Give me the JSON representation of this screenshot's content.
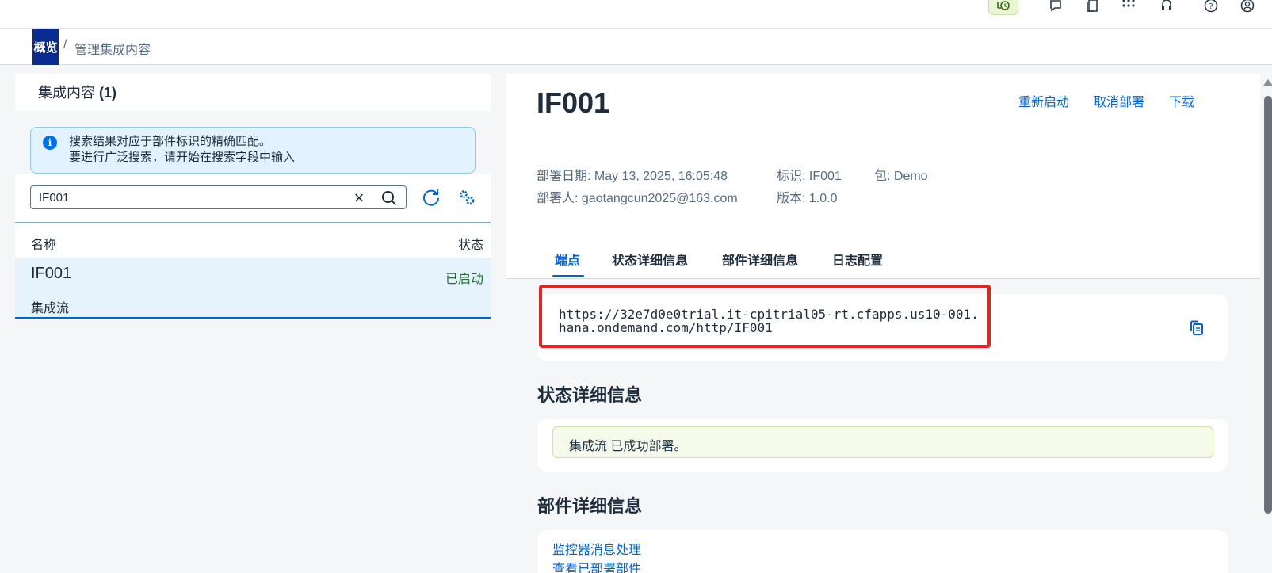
{
  "shell": {
    "icons": [
      "timer-icon",
      "feedback-icon",
      "documents-icon",
      "app-grid-icon",
      "support-icon",
      "help-icon",
      "user-icon"
    ]
  },
  "breadcrumb": {
    "home": "概览",
    "separator": "/",
    "current": "管理集成内容"
  },
  "left": {
    "title": "集成内容",
    "count": "(1)",
    "info_line1": "搜索结果对应于部件标识的精确匹配。",
    "info_line2": "要进行广泛搜索，请开始在搜索字段中输入",
    "search_value": "IF001",
    "columns": {
      "name": "名称",
      "status": "状态"
    },
    "rows": [
      {
        "name": "IF001",
        "type": "集成流",
        "status": "已启动"
      }
    ]
  },
  "detail": {
    "title": "IF001",
    "actions": {
      "restart": "重新启动",
      "undeploy": "取消部署",
      "download": "下载"
    },
    "meta": {
      "deployed_on": "部署日期: May 13, 2025, 16:05:48",
      "deployed_by": "部署人: gaotangcun2025@163.com",
      "id": "标识: IF001",
      "version": "版本: 1.0.0",
      "package": "包: Demo"
    },
    "tabs": [
      "端点",
      "状态详细信息",
      "部件详细信息",
      "日志配置"
    ],
    "selected_tab": "端点",
    "endpoint_url": "https://32e7d0e0trial.it-cpitrial05-rt.cfapps.us10-001.hana.ondemand.com/http/IF001",
    "status_section_title": "状态详细信息",
    "status_message": "集成流 已成功部署。",
    "artifact_section_title": "部件详细信息",
    "links": [
      "监控器消息处理",
      "查看已部署部件"
    ]
  },
  "colors": {
    "accent": "#0064d9",
    "success_text": "#256f3a",
    "highlight_border": "#e8221c",
    "home_tile": "#0a2b8f"
  }
}
